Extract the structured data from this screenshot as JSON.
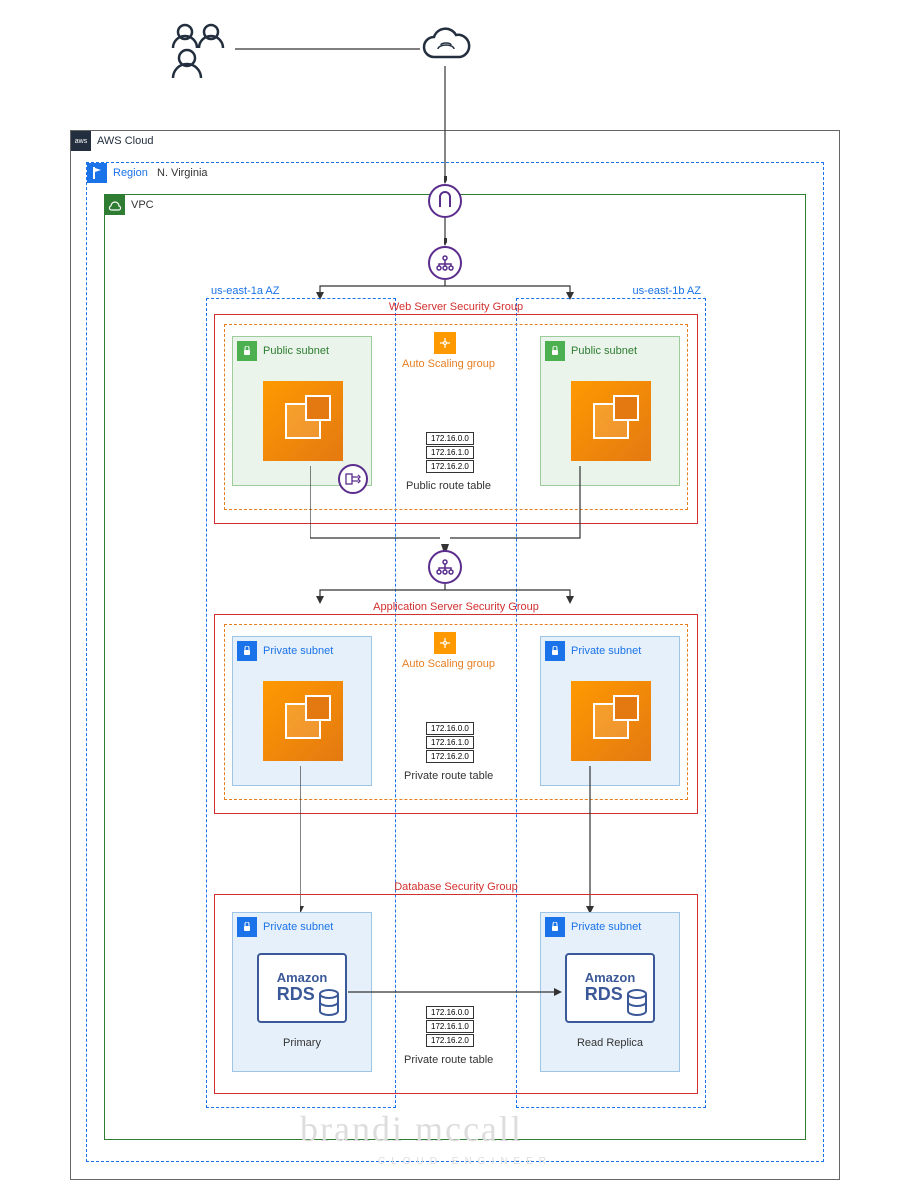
{
  "top": {
    "users_label": "",
    "cloud_label": ""
  },
  "aws_cloud": {
    "label": "AWS Cloud"
  },
  "region": {
    "label": "Region",
    "name": "N. Virginia"
  },
  "vpc": {
    "label": "VPC"
  },
  "az": {
    "a": "us-east-1a AZ",
    "b": "us-east-1b AZ"
  },
  "tiers": {
    "web": {
      "sg_label": "Web Server Security Group",
      "asg_label": "Auto Scaling group",
      "subnet_label": "Public subnet",
      "route_label": "Public route table",
      "routes": [
        "172.16.0.0",
        "172.16.1.0",
        "172.16.2.0"
      ]
    },
    "app": {
      "sg_label": "Application Server Security Group",
      "asg_label": "Auto Scaling group",
      "subnet_label": "Private subnet",
      "route_label": "Private route table",
      "routes": [
        "172.16.0.0",
        "172.16.1.0",
        "172.16.2.0"
      ]
    },
    "db": {
      "sg_label": "Database Security Group",
      "subnet_label": "Private subnet",
      "route_label": "Private route table",
      "routes": [
        "172.16.0.0",
        "172.16.1.0",
        "172.16.2.0"
      ],
      "rds_text1": "Amazon",
      "rds_text2": "RDS",
      "primary_label": "Primary",
      "replica_label": "Read Replica"
    }
  },
  "watermark": {
    "name": "brandi mccall",
    "title": "CLOUD ENGINEER"
  }
}
